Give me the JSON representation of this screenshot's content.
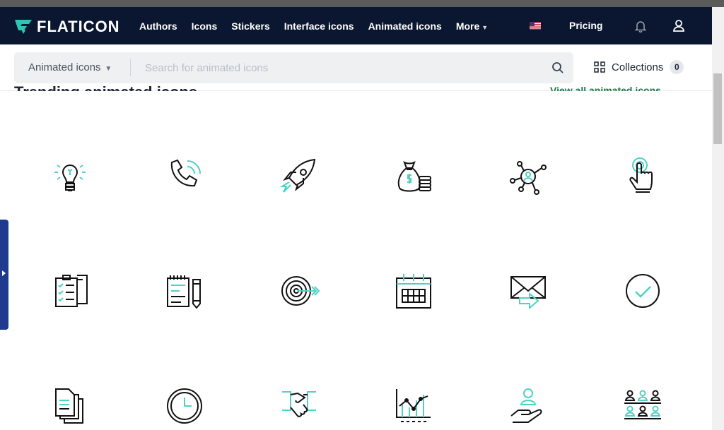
{
  "brand": {
    "name": "FLATICON"
  },
  "nav": {
    "links": [
      "Authors",
      "Icons",
      "Stickers",
      "Interface icons",
      "Animated icons",
      "More"
    ],
    "pricing": "Pricing"
  },
  "search": {
    "type_label": "Animated icons",
    "placeholder": "Search for animated icons"
  },
  "collections": {
    "label": "Collections",
    "count": "0"
  },
  "section": {
    "title": "Trending animated icons",
    "view_all": "View all animated icons"
  },
  "icons": [
    "lightbulb-icon",
    "phone-call-icon",
    "rocket-icon",
    "money-bag-coins-icon",
    "network-user-icon",
    "tap-hand-icon",
    "clipboard-checklist-icon",
    "notepad-pencil-icon",
    "target-arrow-icon",
    "calendar-icon",
    "email-send-icon",
    "check-circle-icon",
    "documents-icon",
    "clock-icon",
    "handshake-icon",
    "line-chart-icon",
    "hand-user-icon",
    "team-icon"
  ],
  "colors": {
    "nav_bg": "#0b1730",
    "accent": "#4fd1c5",
    "view_all": "#1b7c4c"
  }
}
